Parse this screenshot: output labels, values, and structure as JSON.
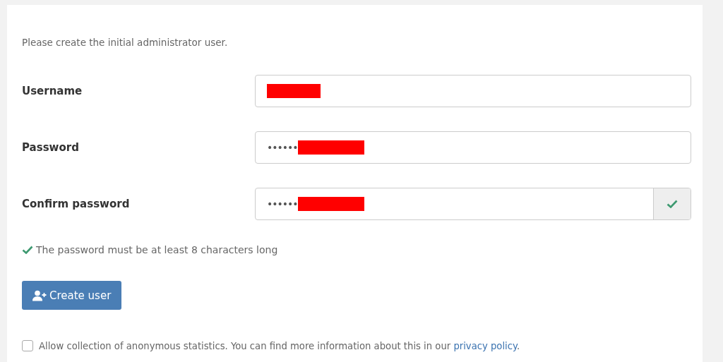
{
  "intro": "Please create the initial administrator user.",
  "fields": [
    {
      "label": "Username",
      "redacted": true,
      "validated": false
    },
    {
      "label": "Password",
      "value": "••••••",
      "redacted": true,
      "validated": false
    },
    {
      "label": "Confirm password",
      "value": "••••••",
      "redacted": true,
      "validated": true
    }
  ],
  "hint": {
    "text": "The password must be at least 8 characters long",
    "met": true
  },
  "button": {
    "label": "Create user"
  },
  "consent": {
    "checked": false,
    "text": "Allow collection of anonymous statistics. You can find more information about this in our ",
    "link": "privacy policy",
    "end": "."
  }
}
